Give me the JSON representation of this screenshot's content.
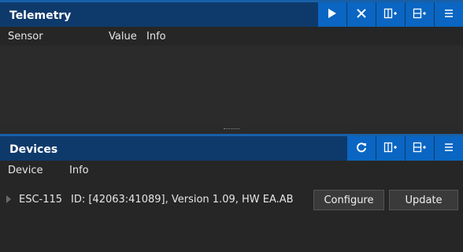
{
  "telemetry": {
    "title": "Telemetry",
    "columns": {
      "sensor": "Sensor",
      "value": "Value",
      "info": "Info"
    }
  },
  "devices": {
    "title": "Devices",
    "columns": {
      "device": "Device",
      "info": "Info"
    },
    "rows": [
      {
        "name": "ESC-115",
        "info": "ID: [42063:41089], Version  1.09, HW EA.AB",
        "configure": "Configure",
        "update": "Update"
      }
    ]
  },
  "icons": {
    "play": "play-icon",
    "close": "close-icon",
    "add_column": "add-column-icon",
    "add_row": "add-row-icon",
    "menu": "menu-icon",
    "refresh": "refresh-icon"
  },
  "colors": {
    "titlebar": "#0e3a6b",
    "accent": "#0a66c2",
    "background": "#2a2a2a"
  }
}
